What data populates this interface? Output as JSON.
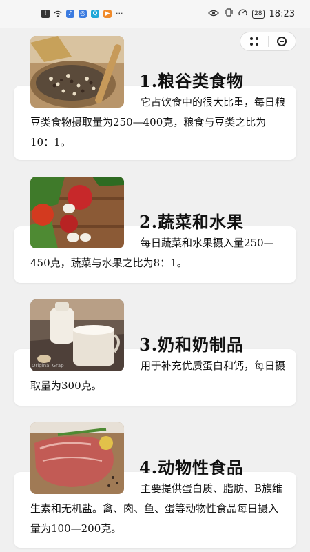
{
  "status_bar": {
    "time": "18:23",
    "battery": "28",
    "icons": [
      "alert-icon",
      "wifi-icon",
      "app-icon-1",
      "app-icon-2",
      "app-icon-3",
      "app-icon-4",
      "more-icon"
    ]
  },
  "capsule": {
    "menu_icon": "more-dots-icon",
    "close_icon": "close-circle-icon"
  },
  "sections": [
    {
      "title": "1.粮谷类食物",
      "text": "它占饮食中的很大比重，每日粮豆类食物摄取量为250—400克，粮食与豆类之比为10：1。",
      "image": "grains-image"
    },
    {
      "title": "2.蔬菜和水果",
      "text": "每日蔬菜和水果摄入量250—450克，蔬菜与水果之比为8：1。",
      "image": "vegetables-image"
    },
    {
      "title": "3.奶和奶制品",
      "text": "用于补充优质蛋白和钙，每日摄取量为300克。",
      "image": "milk-image",
      "image_caption": "Original Grap"
    },
    {
      "title": "4.动物性食品",
      "text": "主要提供蛋白质、脂肪、B族维生素和无机盐。禽、肉、鱼、蛋等动物性食品每日摄入量为100—200克。",
      "image": "meat-image"
    }
  ]
}
